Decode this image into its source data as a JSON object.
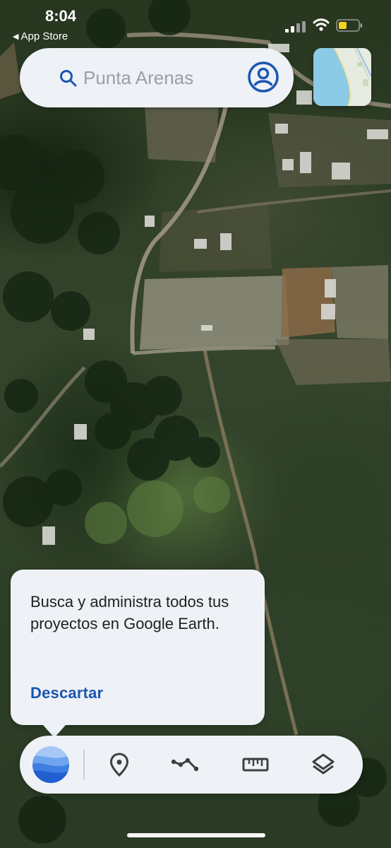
{
  "status_bar": {
    "time": "8:04",
    "back_app": "App Store",
    "battery_color": "#f7d21a"
  },
  "search": {
    "placeholder": "Punta Arenas",
    "icon": "search-icon",
    "account_icon": "account-circle-icon"
  },
  "minimap": {
    "icon": "map-thumbnail"
  },
  "tooltip": {
    "message": "Busca y administra todos tus proyectos en Google Earth.",
    "dismiss_label": "Descartar"
  },
  "toolbar": {
    "items": [
      {
        "name": "google-earth-projects",
        "icon": "earth-logo-icon"
      },
      {
        "name": "add-placemark",
        "icon": "map-pin-icon"
      },
      {
        "name": "draw-path",
        "icon": "path-icon"
      },
      {
        "name": "measure",
        "icon": "ruler-icon"
      },
      {
        "name": "map-layers",
        "icon": "layers-icon"
      }
    ]
  },
  "colors": {
    "accent": "#1a56b0",
    "panel": "#eef1f6"
  }
}
